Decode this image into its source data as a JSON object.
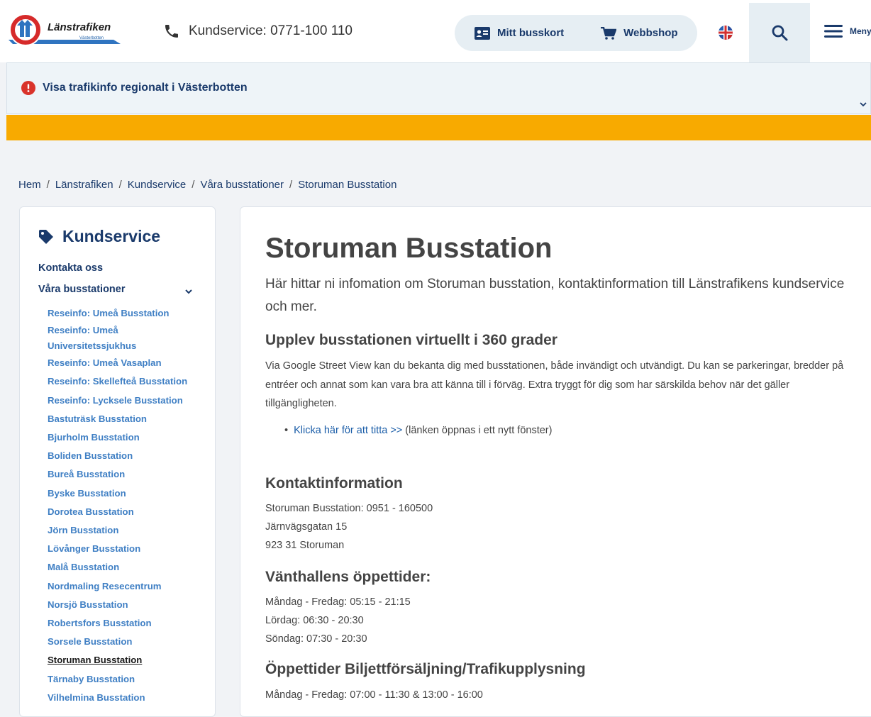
{
  "header": {
    "logo_text": "Länstrafiken",
    "logo_sub": "Västerbotten",
    "phone": "Kundservice: 0771-100 110",
    "mitt_busskort": "Mitt busskort",
    "webbshop": "Webbshop",
    "menu": "Meny"
  },
  "traffic": {
    "text": "Visa trafikinfo regionalt i Västerbotten"
  },
  "breadcrumb": [
    "Hem",
    "Länstrafiken",
    "Kundservice",
    "Våra busstationer",
    "Storuman Busstation"
  ],
  "sidebar": {
    "title": "Kundservice",
    "kontakta": "Kontakta oss",
    "vara": "Våra busstationer",
    "items": [
      "Reseinfo: Umeå Busstation",
      "Reseinfo: Umeå Universitetssjukhus",
      "Reseinfo: Umeå Vasaplan",
      "Reseinfo: Skellefteå Busstation",
      "Reseinfo: Lycksele Busstation",
      "Bastuträsk Busstation",
      "Bjurholm Busstation",
      "Boliden Busstation",
      "Bureå Busstation",
      "Byske Busstation",
      "Dorotea Busstation",
      "Jörn Busstation",
      "Lövånger Busstation",
      "Malå Busstation",
      "Nordmaling Resecentrum",
      "Norsjö Busstation",
      "Robertsfors Busstation",
      "Sorsele Busstation",
      "Storuman Busstation",
      "Tärnaby Busstation",
      "Vilhelmina Busstation"
    ]
  },
  "main": {
    "title": "Storuman Busstation",
    "lead": "Här hittar ni infomation om Storuman busstation, kontaktinformation till Länstrafikens kundservice och mer.",
    "h_virtual": "Upplev busstationen virtuellt i 360 grader",
    "p_virtual": "Via Google Street View kan du bekanta dig med busstationen, både invändigt och utvändigt. Du kan se parkeringar, bredder på entréer och annat som kan vara bra att känna till i förväg. Extra tryggt för dig som har särskilda behov när det gäller tillgängligheten.",
    "link": "Klicka här för att titta >>",
    "link_note": " (länken öppnas i ett nytt fönster)",
    "h_kontakt": "Kontaktinformation",
    "kontakt": [
      "Storuman Busstation: 0951 - 160500",
      "Järnvägsgatan 15",
      "923 31 Storuman"
    ],
    "h_vant": "Vänthallens öppettider:",
    "vant": [
      "Måndag - Fredag: 05:15 - 21:15",
      "Lördag: 06:30 - 20:30",
      "Söndag: 07:30 - 20:30"
    ],
    "h_biljett": "Öppettider Biljettförsäljning/Trafikupplysning",
    "biljett": [
      "Måndag - Fredag: 07:00 - 11:30 & 13:00 - 16:00"
    ]
  },
  "colors": {
    "navy": "#1a3a6b",
    "link_blue": "#3f7fc4",
    "orange": "#f8aa00",
    "alert_red": "#d9332b"
  }
}
